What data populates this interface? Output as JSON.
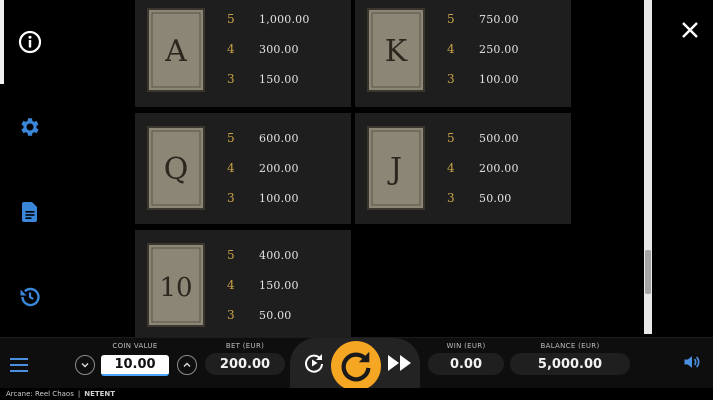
{
  "sidebar": {
    "items": [
      {
        "icon": "info-icon"
      },
      {
        "icon": "gear-icon"
      },
      {
        "icon": "document-icon"
      },
      {
        "icon": "history-icon"
      }
    ]
  },
  "paytable": {
    "cards": [
      {
        "symbol": "A",
        "rows": [
          {
            "count": "5",
            "value": "1,000.00"
          },
          {
            "count": "4",
            "value": "300.00"
          },
          {
            "count": "3",
            "value": "150.00"
          }
        ]
      },
      {
        "symbol": "K",
        "rows": [
          {
            "count": "5",
            "value": "750.00"
          },
          {
            "count": "4",
            "value": "250.00"
          },
          {
            "count": "3",
            "value": "100.00"
          }
        ]
      },
      {
        "symbol": "Q",
        "rows": [
          {
            "count": "5",
            "value": "600.00"
          },
          {
            "count": "4",
            "value": "200.00"
          },
          {
            "count": "3",
            "value": "100.00"
          }
        ]
      },
      {
        "symbol": "J",
        "rows": [
          {
            "count": "5",
            "value": "500.00"
          },
          {
            "count": "4",
            "value": "200.00"
          },
          {
            "count": "3",
            "value": "50.00"
          }
        ]
      },
      {
        "symbol": "10",
        "rows": [
          {
            "count": "5",
            "value": "400.00"
          },
          {
            "count": "4",
            "value": "150.00"
          },
          {
            "count": "3",
            "value": "50.00"
          }
        ]
      }
    ]
  },
  "controls": {
    "coin_value_label": "COIN VALUE",
    "coin_value": "10.00",
    "bet_label": "BET (EUR)",
    "bet_value": "200.00",
    "win_label": "WIN (EUR)",
    "win_value": "0.00",
    "balance_label": "BALANCE (EUR)",
    "balance_value": "5,000.00"
  },
  "footer": {
    "game_name": "Arcane: Reel Chaos",
    "separator": "|",
    "brand": "NETENT"
  },
  "colors": {
    "gold": "#c9a247",
    "spin_orange": "#f5a623",
    "card_bg": "#1e1e1e",
    "sidebar_icon": "#3a86d8"
  }
}
